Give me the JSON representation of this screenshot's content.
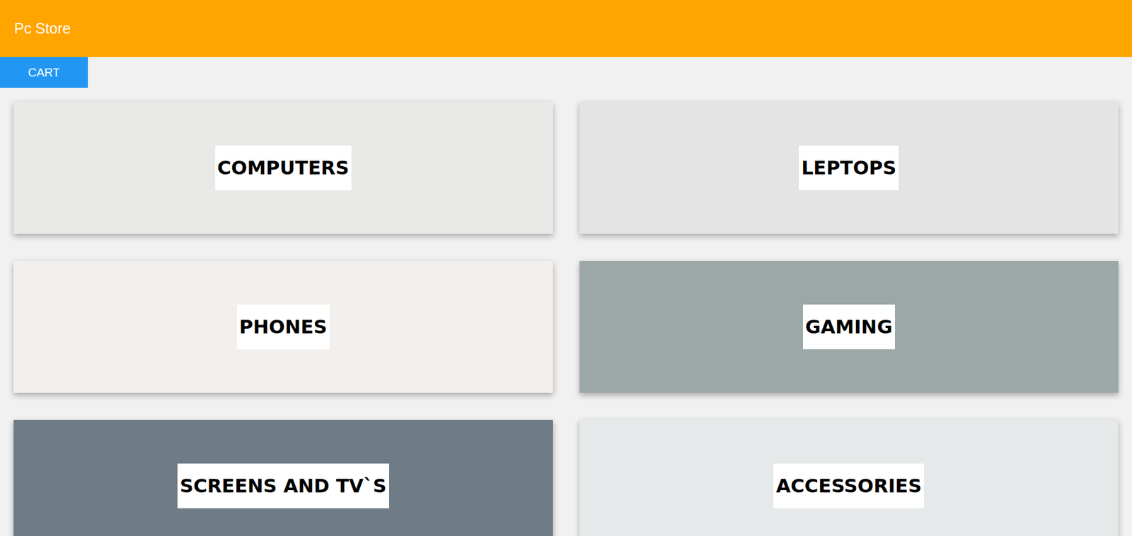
{
  "header": {
    "title": "Pc Store"
  },
  "cart_button": {
    "label": "CART"
  },
  "categories": [
    {
      "label": "COMPUTERS",
      "color": "#e9e9e7"
    },
    {
      "label": "LEPTOPS",
      "color": "#e4e4e4"
    },
    {
      "label": "PHONES",
      "color": "#f2efec"
    },
    {
      "label": "GAMING",
      "color": "#9ca8a8"
    },
    {
      "label": "SCREENS AND TV`S",
      "color": "#6f7c86"
    },
    {
      "label": "ACCESSORIES",
      "color": "#e6e9ea"
    }
  ]
}
